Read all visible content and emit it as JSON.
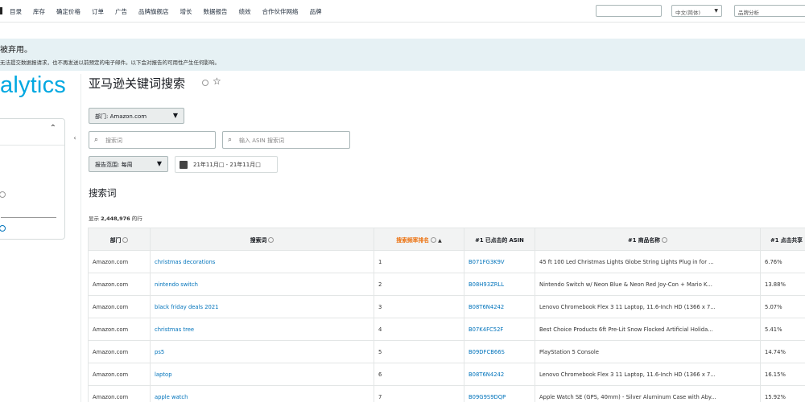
{
  "topnav": {
    "items": [
      "目录",
      "库存",
      "确定价格",
      "订单",
      "广告",
      "品牌旗舰店",
      "增长",
      "数据报告",
      "绩效",
      "合作伙伴网络",
      "品牌"
    ],
    "language": "中文(简体)",
    "search_placeholder": "品牌分析"
  },
  "banner": {
    "line1": "被弃用。",
    "line2": "无法提交数据报请求，也不再发送以前预定的电子邮件。以下会对报告的可用性产生任何影响。"
  },
  "logo_text": "alytics",
  "page": {
    "title": "亚马逊关键词搜索",
    "department_dropdown": "部门: Amazon.com",
    "search_placeholder": "搜索词",
    "asin_placeholder": "输入 ASIN 搜索词",
    "report_range_dropdown": "报告范围: 每周",
    "date_range": "21年11月□ - 21年11月□",
    "section_title": "搜索词",
    "count_prefix": "显示 ",
    "count_value": "2,448,976",
    "count_suffix": " 的行"
  },
  "table": {
    "headers": [
      "部门",
      "搜索词",
      "搜索频率排名",
      "#1 已点击的 ASIN",
      "#1 商品名称",
      "#1 点击共享"
    ],
    "rows": [
      [
        "Amazon.com",
        "christmas decorations",
        "1",
        "B071FG3K9V",
        "45 ft 100 Led Christmas Lights Globe String Lights Plug in for ...",
        "6.76%"
      ],
      [
        "Amazon.com",
        "nintendo switch",
        "2",
        "B08H93ZRLL",
        "Nintendo Switch w/ Neon Blue & Neon Red Joy-Con + Mario K...",
        "13.88%"
      ],
      [
        "Amazon.com",
        "black friday deals 2021",
        "3",
        "B08T6N4242",
        "Lenovo Chromebook Flex 3 11 Laptop, 11.6-Inch HD (1366 x 7...",
        "5.07%"
      ],
      [
        "Amazon.com",
        "christmas tree",
        "4",
        "B07K4FC52F",
        "Best Choice Products 6ft Pre-Lit Snow Flocked Artificial Holida...",
        "5.41%"
      ],
      [
        "Amazon.com",
        "ps5",
        "5",
        "B09DFCB66S",
        "PlayStation 5 Console",
        "14.74%"
      ],
      [
        "Amazon.com",
        "laptop",
        "6",
        "B08T6N4242",
        "Lenovo Chromebook Flex 3 11 Laptop, 11.6-Inch HD (1366 x 7...",
        "16.15%"
      ],
      [
        "Amazon.com",
        "apple watch",
        "7",
        "B09G9S9DQP",
        "Apple Watch SE (GPS, 40mm) - Silver Aluminum Case with Aby...",
        "15.92%"
      ]
    ]
  }
}
